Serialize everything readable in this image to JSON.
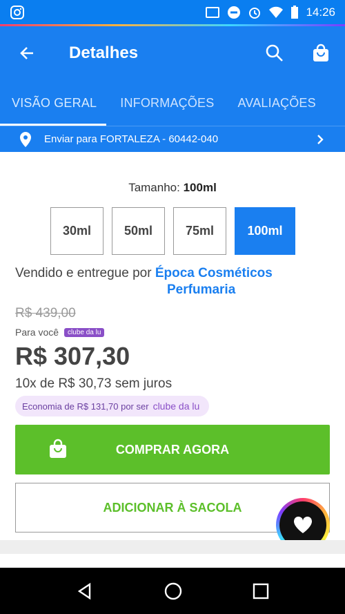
{
  "status": {
    "time": "14:26"
  },
  "appbar": {
    "title": "Detalhes"
  },
  "tabs": [
    "VISÃO GERAL",
    "INFORMAÇÕES",
    "AVALIAÇÕES"
  ],
  "shipping": {
    "label": "Enviar para FORTALEZA - 60442-040"
  },
  "size": {
    "label": "Tamanho:",
    "selected": "100ml",
    "options": [
      "30ml",
      "50ml",
      "75ml",
      "100ml"
    ]
  },
  "seller": {
    "prefix": "Vendido e entregue por",
    "name_line1": "Época Cosméticos",
    "name_line2": "Perfumaria"
  },
  "pricing": {
    "old_price": "R$ 439,00",
    "para_voce": "Para você",
    "clube_badge": "clube da lu",
    "price": "R$ 307,30",
    "installments": "10x de R$ 30,73 sem juros",
    "economia": "Economia de R$ 131,70 por ser",
    "economia_logo": "clube da lu"
  },
  "actions": {
    "buy_now": "COMPRAR AGORA",
    "add_to_bag": "ADICIONAR À SACOLA"
  },
  "colors": {
    "primary": "#1a7ff0",
    "buy": "#5cbf2a",
    "clube": "#8a4fc7"
  }
}
